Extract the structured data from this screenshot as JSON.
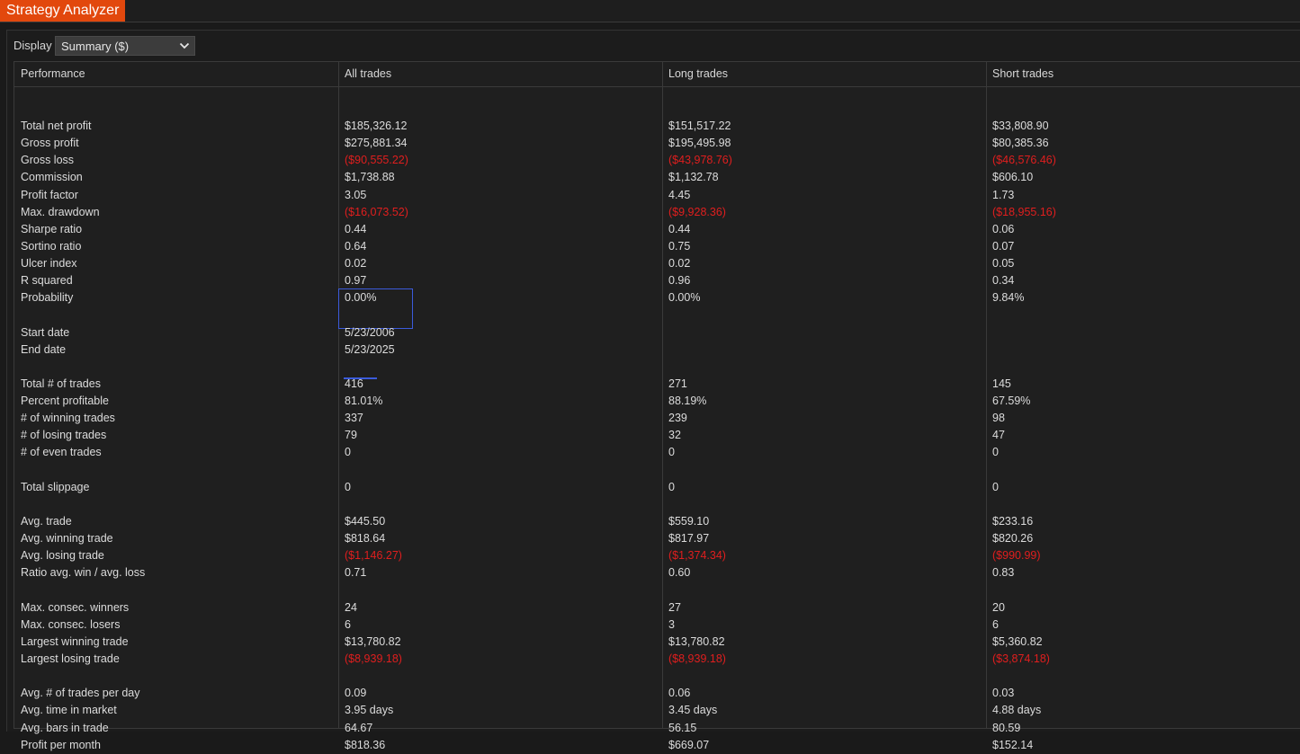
{
  "app": {
    "title": "Strategy Analyzer"
  },
  "display": {
    "label": "Display",
    "selected": "Summary ($)",
    "dropdown_icon": "chevron-down-icon"
  },
  "columns": [
    "Performance",
    "All trades",
    "Long trades",
    "Short trades"
  ],
  "colors": {
    "accent": "#e2480d",
    "negative": "#e01e1e",
    "selection": "#3b5bdb"
  },
  "rows": [
    {
      "label": "Total net profit",
      "values": [
        "$185,326.12",
        "$151,517.22",
        "$33,808.90"
      ],
      "negative": false
    },
    {
      "label": "Gross profit",
      "values": [
        "$275,881.34",
        "$195,495.98",
        "$80,385.36"
      ],
      "negative": false
    },
    {
      "label": "Gross loss",
      "values": [
        "($90,555.22)",
        "($43,978.76)",
        "($46,576.46)"
      ],
      "negative": true
    },
    {
      "label": "Commission",
      "values": [
        "$1,738.88",
        "$1,132.78",
        "$606.10"
      ],
      "negative": false
    },
    {
      "label": "Profit factor",
      "values": [
        "3.05",
        "4.45",
        "1.73"
      ],
      "negative": false
    },
    {
      "label": "Max. drawdown",
      "values": [
        "($16,073.52)",
        "($9,928.36)",
        "($18,955.16)"
      ],
      "negative": true
    },
    {
      "label": "Sharpe ratio",
      "values": [
        "0.44",
        "0.44",
        "0.06"
      ],
      "negative": false
    },
    {
      "label": "Sortino ratio",
      "values": [
        "0.64",
        "0.75",
        "0.07"
      ],
      "negative": false
    },
    {
      "label": "Ulcer index",
      "values": [
        "0.02",
        "0.02",
        "0.05"
      ],
      "negative": false
    },
    {
      "label": "R squared",
      "values": [
        "0.97",
        "0.96",
        "0.34"
      ],
      "negative": false
    },
    {
      "label": "Probability",
      "values": [
        "0.00%",
        "0.00%",
        "9.84%"
      ],
      "negative": false
    },
    null,
    {
      "label": "Start date",
      "values": [
        "5/23/2006",
        "",
        ""
      ],
      "negative": false
    },
    {
      "label": "End date",
      "values": [
        "5/23/2025",
        "",
        ""
      ],
      "negative": false
    },
    null,
    {
      "label": "Total # of trades",
      "values": [
        "416",
        "271",
        "145"
      ],
      "negative": false
    },
    {
      "label": "Percent profitable",
      "values": [
        "81.01%",
        "88.19%",
        "67.59%"
      ],
      "negative": false
    },
    {
      "label": "# of winning trades",
      "values": [
        "337",
        "239",
        "98"
      ],
      "negative": false
    },
    {
      "label": "# of losing trades",
      "values": [
        "79",
        "32",
        "47"
      ],
      "negative": false
    },
    {
      "label": "# of even trades",
      "values": [
        "0",
        "0",
        "0"
      ],
      "negative": false
    },
    null,
    {
      "label": "Total slippage",
      "values": [
        "0",
        "0",
        "0"
      ],
      "negative": false
    },
    null,
    {
      "label": "Avg. trade",
      "values": [
        "$445.50",
        "$559.10",
        "$233.16"
      ],
      "negative": false
    },
    {
      "label": "Avg. winning trade",
      "values": [
        "$818.64",
        "$817.97",
        "$820.26"
      ],
      "negative": false
    },
    {
      "label": "Avg. losing trade",
      "values": [
        "($1,146.27)",
        "($1,374.34)",
        "($990.99)"
      ],
      "negative": true
    },
    {
      "label": "Ratio avg. win / avg. loss",
      "values": [
        "0.71",
        "0.60",
        "0.83"
      ],
      "negative": false
    },
    null,
    {
      "label": "Max. consec. winners",
      "values": [
        "24",
        "27",
        "20"
      ],
      "negative": false
    },
    {
      "label": "Max. consec. losers",
      "values": [
        "6",
        "3",
        "6"
      ],
      "negative": false
    },
    {
      "label": "Largest winning trade",
      "values": [
        "$13,780.82",
        "$13,780.82",
        "$5,360.82"
      ],
      "negative": false
    },
    {
      "label": "Largest losing trade",
      "values": [
        "($8,939.18)",
        "($8,939.18)",
        "($3,874.18)"
      ],
      "negative": true
    },
    null,
    {
      "label": "Avg. # of trades per day",
      "values": [
        "0.09",
        "0.06",
        "0.03"
      ],
      "negative": false
    },
    {
      "label": "Avg. time in market",
      "values": [
        "3.95 days",
        "3.45 days",
        "4.88 days"
      ],
      "negative": false
    },
    {
      "label": "Avg. bars in trade",
      "values": [
        "64.67",
        "56.15",
        "80.59"
      ],
      "negative": false
    },
    {
      "label": "Profit per month",
      "values": [
        "$818.36",
        "$669.07",
        "$152.14"
      ],
      "negative": false
    }
  ]
}
